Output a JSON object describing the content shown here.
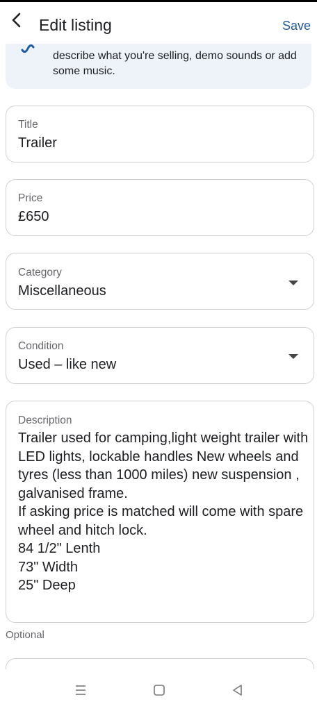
{
  "header": {
    "title": "Edit listing",
    "save_label": "Save",
    "back_icon": "chevron-left-icon"
  },
  "banner": {
    "icon": "sound-wave-icon",
    "text": "describe what you're selling, demo sounds or add some music."
  },
  "fields": {
    "title": {
      "label": "Title",
      "value": "Trailer"
    },
    "price": {
      "label": "Price",
      "value": "£650"
    },
    "category": {
      "label": "Category",
      "value": "Miscellaneous"
    },
    "condition": {
      "label": "Condition",
      "value": "Used – like new"
    },
    "description": {
      "label": "Description",
      "value": "Trailer used for camping,light weight trailer with LED lights, lockable handles New wheels and tyres (less than 1000 miles) new suspension , galvanised frame.\nIf asking price is matched will come with spare wheel and hitch lock.\n84 1/2\" Lenth\n73\" Width\n25\" Deep"
    }
  },
  "optional_label": "Optional",
  "navbar": {
    "items": [
      "menu-icon",
      "home-square-icon",
      "back-triangle-icon"
    ]
  },
  "colors": {
    "accent": "#1f5aa0",
    "banner_bg": "#eef3f9",
    "border": "#ced0d4",
    "label": "#65676b"
  }
}
